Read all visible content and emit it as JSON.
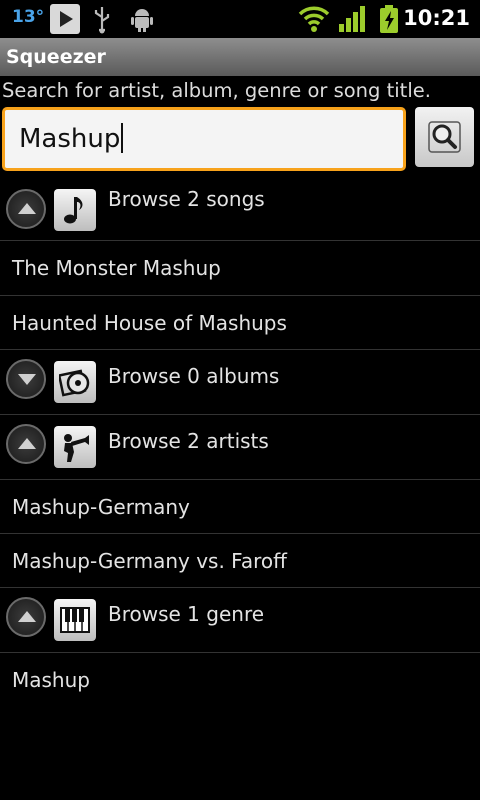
{
  "status_bar": {
    "temperature": "13°",
    "time": "10:21",
    "icons": [
      "play-icon",
      "usb-icon",
      "android-debug-icon",
      "wifi-icon",
      "signal-icon",
      "battery-charging-icon"
    ]
  },
  "app": {
    "title": "Squeezer"
  },
  "search": {
    "hint": "Search for artist, album, genre or song title.",
    "value": "Mashup"
  },
  "results": {
    "songs": {
      "label": "Browse 2 songs",
      "state": "expanded",
      "items": [
        "The Monster Mashup",
        "Haunted House of Mashups"
      ]
    },
    "albums": {
      "label": "Browse 0 albums",
      "state": "collapsed",
      "items": []
    },
    "artists": {
      "label": "Browse 2 artists",
      "state": "expanded",
      "items": [
        "Mashup-Germany",
        "Mashup-Germany vs. Faroff"
      ]
    },
    "genres": {
      "label": "Browse 1 genre",
      "state": "expanded",
      "items": [
        "Mashup"
      ]
    }
  },
  "colors": {
    "accent": "#f7a21b",
    "status_blue": "#4aa3e8",
    "status_green": "#9ccc2c"
  }
}
